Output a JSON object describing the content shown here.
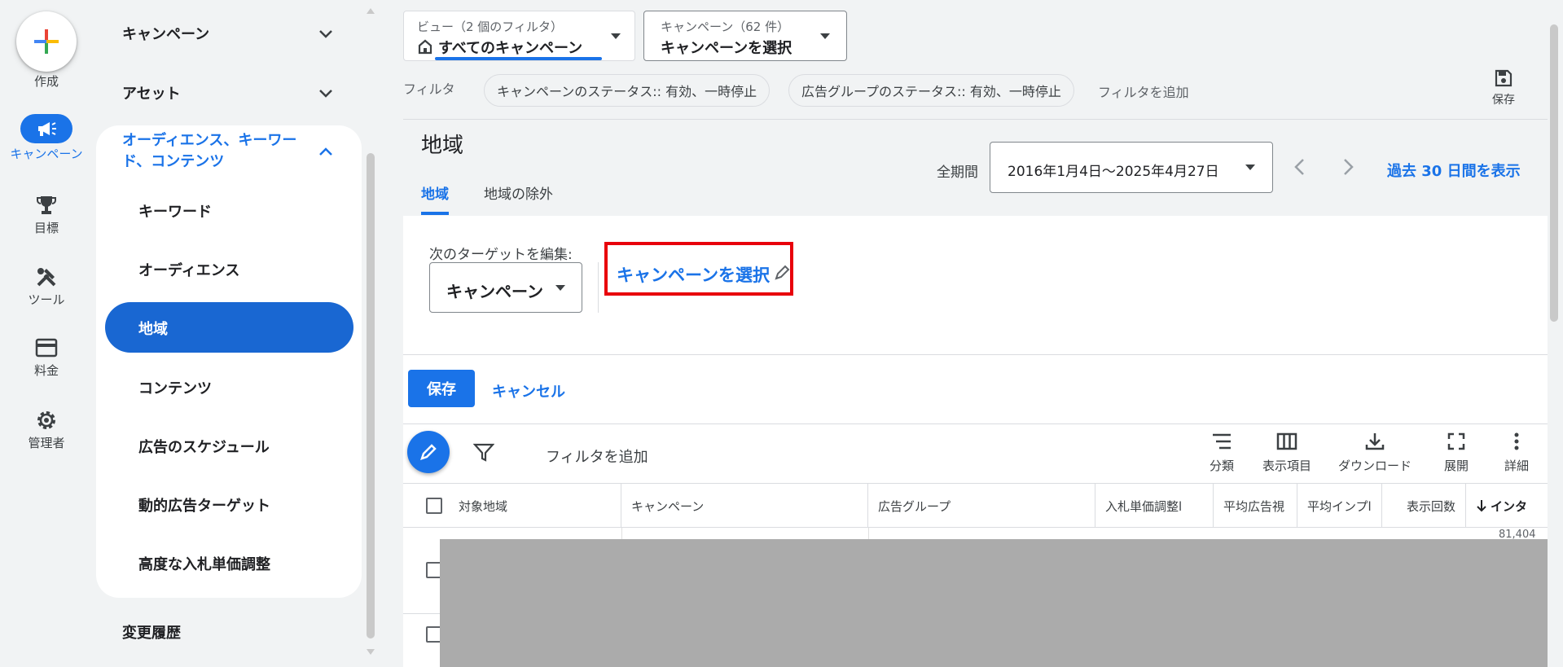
{
  "rail": {
    "create_label": "作成",
    "items": [
      {
        "label": "キャンペーン",
        "icon": "megaphone-icon"
      },
      {
        "label": "目標",
        "icon": "trophy-icon"
      },
      {
        "label": "ツール",
        "icon": "tools-icon"
      },
      {
        "label": "料金",
        "icon": "credit-card-icon"
      },
      {
        "label": "管理者",
        "icon": "gear-icon"
      }
    ]
  },
  "nav": {
    "campaigns": "キャンペーン",
    "assets": "アセット",
    "audiences_group": "オーディエンス、キーワード、コンテンツ",
    "sub_items": [
      "キーワード",
      "オーディエンス",
      "地域",
      "コンテンツ",
      "広告のスケジュール",
      "動的広告ターゲット",
      "高度な入札単価調整"
    ],
    "change_history": "変更履歴"
  },
  "topbar": {
    "view_caption": "ビュー（2 個のフィルタ）",
    "view_value": "すべてのキャンペーン",
    "campaign_caption": "キャンペーン（62 件）",
    "campaign_value": "キャンペーンを選択",
    "filter_label": "フィルタ",
    "chips": [
      "キャンペーンのステータス:: 有効、一時停止",
      "広告グループのステータス:: 有効、一時停止"
    ],
    "add_filter": "フィルタを追加",
    "save_label": "保存"
  },
  "page": {
    "title": "地域",
    "tabs": [
      "地域",
      "地域の除外"
    ],
    "period_label": "全期間",
    "date_range": "2016年1月4日～2025年4月27日",
    "last30": "過去 30 日間を表示"
  },
  "editor": {
    "target_label": "次のターゲットを編集:",
    "target_select": "キャンペーン",
    "select_campaign_link": "キャンペーンを選択",
    "save_button": "保存",
    "cancel_button": "キャンセル"
  },
  "table": {
    "add_filter": "フィルタを追加",
    "tools": [
      "分類",
      "表示項目",
      "ダウンロード",
      "展開",
      "詳細"
    ],
    "columns": [
      "対象地域",
      "キャンペーン",
      "広告グループ",
      "入札単価調整l",
      "平均広告視",
      "平均インプl",
      "表示回数",
      "インタ"
    ],
    "partial_value": "81,404"
  },
  "colors": {
    "accent": "#1a73e8",
    "nav_active": "#1967d2",
    "highlight_box": "#e8000b",
    "redaction": "#ababab"
  }
}
